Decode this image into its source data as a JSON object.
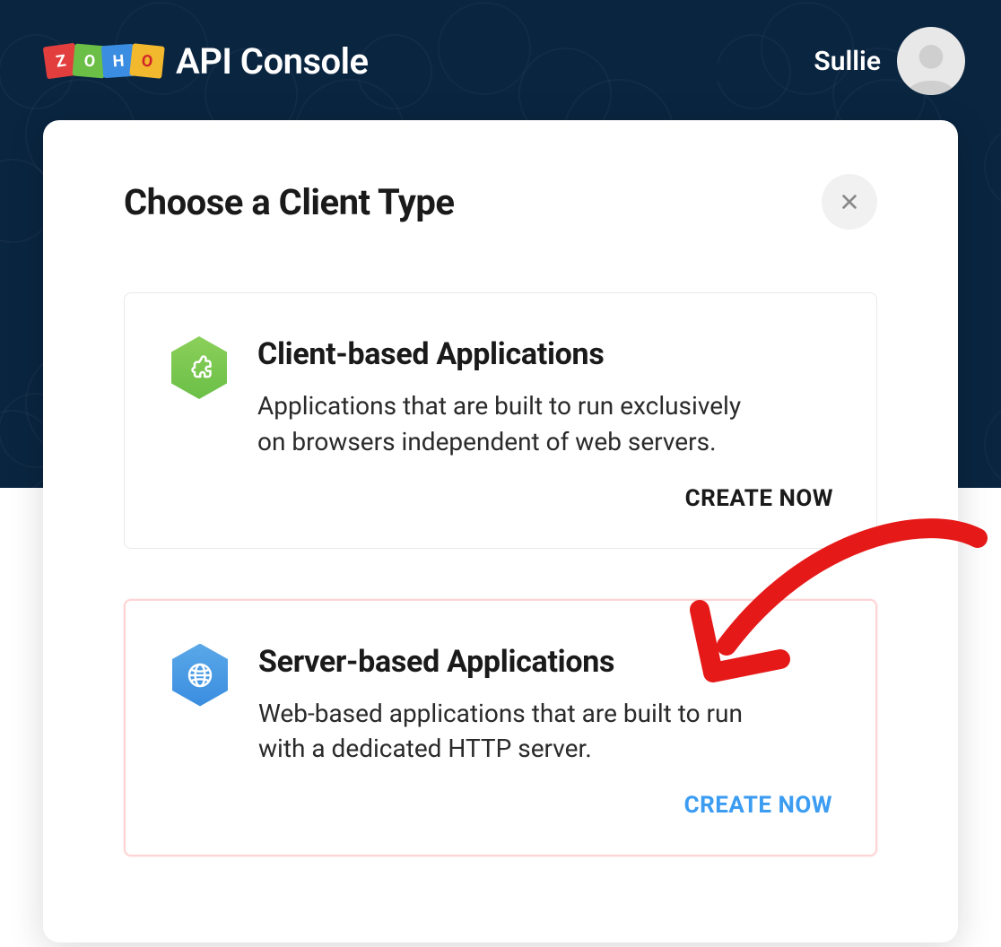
{
  "header": {
    "logo_letters": [
      "Z",
      "O",
      "H",
      "O"
    ],
    "app_title": "API Console",
    "username": "Sullie"
  },
  "modal": {
    "title": "Choose a Client Type",
    "cards": [
      {
        "title": "Client-based Applications",
        "desc": "Applications that are built to run exclusively on browsers independent of web servers.",
        "action": "CREATE NOW"
      },
      {
        "title": "Server-based Applications",
        "desc": "Web-based applications that are built to run with a dedicated HTTP server.",
        "action": "CREATE NOW"
      }
    ]
  }
}
